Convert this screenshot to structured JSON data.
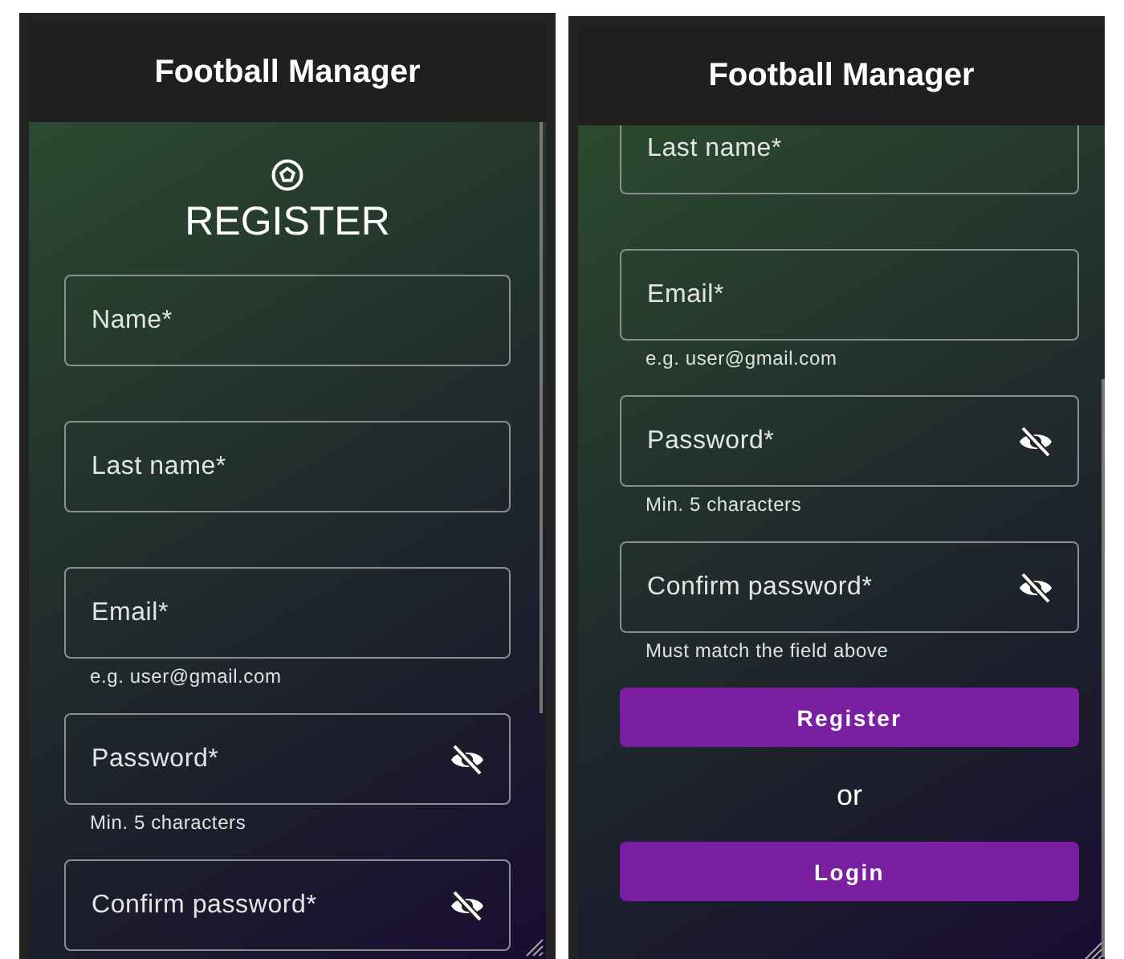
{
  "screens": [
    {
      "title": "Football Manager",
      "scrolled": false,
      "heading": "REGISTER",
      "fields": [
        {
          "label": "Name*",
          "kind": "text"
        },
        {
          "label": "Last name*",
          "kind": "text"
        },
        {
          "label": "Email*",
          "kind": "text",
          "helper": "e.g. user@gmail.com"
        },
        {
          "label": "Password*",
          "kind": "password",
          "helper": "Min. 5 characters"
        },
        {
          "label": "Confirm password*",
          "kind": "password"
        }
      ]
    },
    {
      "title": "Football Manager",
      "scrolled": true,
      "fields": [
        {
          "label": "Last name*",
          "kind": "text"
        },
        {
          "label": "Email*",
          "kind": "text",
          "helper": "e.g. user@gmail.com"
        },
        {
          "label": "Password*",
          "kind": "password",
          "helper": "Min. 5 characters"
        },
        {
          "label": "Confirm password*",
          "kind": "password",
          "helper": "Must match the field above"
        }
      ],
      "buttons": [
        "Register",
        "Login"
      ],
      "separator": "or"
    }
  ]
}
